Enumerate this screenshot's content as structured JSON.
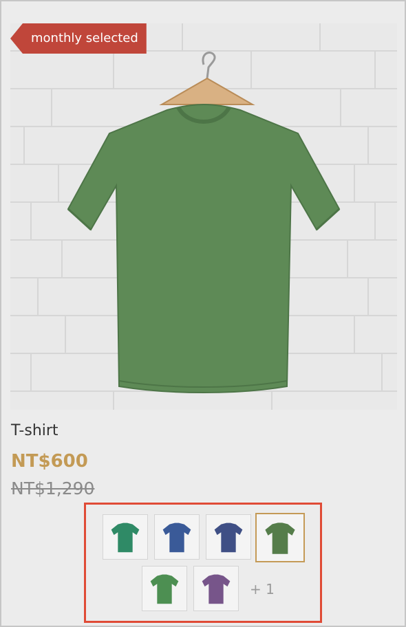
{
  "product": {
    "badge": "monthly selected",
    "title": "T-shirt",
    "price": "NT$600",
    "original_price": "NT$1,290",
    "image": {
      "subject": "green-tshirt-on-hanger",
      "shirt_color": "#5e8a56",
      "wall_color": "#e8e8e8"
    }
  },
  "swatches": {
    "items": [
      {
        "color": "#2f8a66",
        "selected": false
      },
      {
        "color": "#3a5a98",
        "selected": false
      },
      {
        "color": "#3f4f85",
        "selected": false
      },
      {
        "color": "#557d4a",
        "selected": true
      },
      {
        "color": "#4d8f52",
        "selected": false
      },
      {
        "color": "#77558a",
        "selected": false
      }
    ],
    "more_label": "+ 1"
  },
  "colors": {
    "badge": "#c0463a",
    "price": "#c39a55",
    "highlight_border": "#e04b36",
    "selected_border": "#c49a56"
  }
}
